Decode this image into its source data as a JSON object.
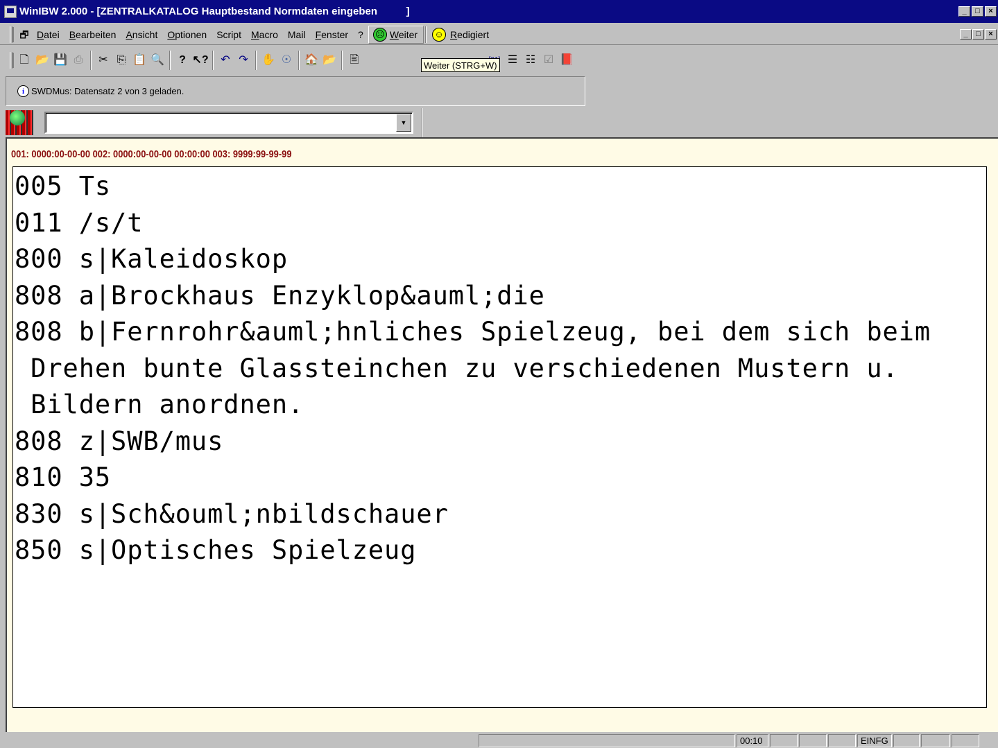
{
  "window": {
    "title": "WinIBW 2.000 - [ZENTRALKATALOG Hauptbestand Normdaten eingeben          ]",
    "controls": [
      "_",
      "□",
      "×"
    ]
  },
  "menubar": {
    "items": [
      "Datei",
      "Bearbeiten",
      "Ansicht",
      "Optionen",
      "Script",
      "Macro",
      "Mail",
      "Fenster",
      "?"
    ],
    "weiter_label": "Weiter",
    "redigiert_label": "Redigiert",
    "mdi_controls": [
      "_",
      "□",
      "×"
    ]
  },
  "toolbar": {
    "icons": [
      "new-document-icon",
      "open-folder-icon",
      "save-icon",
      "print-icon",
      "cut-icon",
      "copy-icon",
      "paste-icon",
      "find-icon",
      "help-icon",
      "context-help-icon",
      "undo-icon",
      "redo-icon",
      "stop-hand-icon",
      "search-globe-icon",
      "home-icon",
      "open-folder-icon-2",
      "edit-record-icon"
    ],
    "tooltip": "Weiter (STRG+W)",
    "right_icons": [
      "minus-icon",
      "field-01-icon",
      "list-up-icon",
      "list-down-icon",
      "validate-icon",
      "book-icon"
    ]
  },
  "info": {
    "message": "SWDMus: Datensatz 2 von 3 geladen."
  },
  "combo": {
    "value": ""
  },
  "record": {
    "header": "001: 0000:00-00-00 002: 0000:00-00-00 00:00:00 003: 9999:99-99-99",
    "lines": [
      "005 Ts",
      "011 /s/t",
      "800 s|Kaleidoskop",
      "808 a|Brockhaus Enzyklop&auml;die",
      "808 b|Fernrohr&auml;hnliches Spielzeug, bei dem sich beim",
      " Drehen bunte Glassteinchen zu verschiedenen Mustern u.",
      " Bildern anordnen.",
      "808 z|SWB/mus",
      "810 35",
      "830 s|Sch&ouml;nbildschauer",
      "850 s|Optisches Spielzeug"
    ]
  },
  "statusbar": {
    "time": "00:10",
    "mode": "EINFG"
  }
}
